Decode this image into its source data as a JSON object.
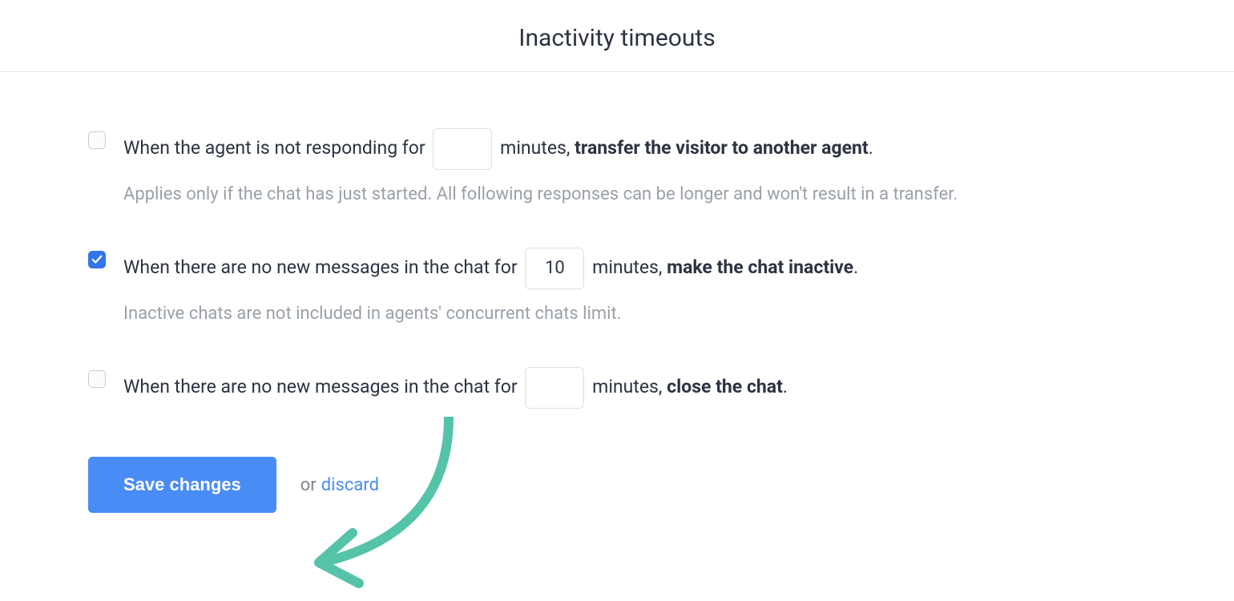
{
  "header": {
    "title": "Inactivity timeouts"
  },
  "options": {
    "transfer": {
      "checked": false,
      "pre": "When the agent is not responding for",
      "value": "",
      "mid": "minutes,",
      "bold": "transfer the visitor to another agent",
      "post": ".",
      "sub": "Applies only if the chat has just started. All following responses can be longer and won't result in a transfer."
    },
    "inactive": {
      "checked": true,
      "pre": "When there are no new messages in the chat for",
      "value": "10",
      "mid": "minutes,",
      "bold": "make the chat inactive",
      "post": ".",
      "sub": "Inactive chats are not included in agents' concurrent chats limit."
    },
    "close": {
      "checked": false,
      "pre": "When there are no new messages in the chat for",
      "value": "",
      "mid": "minutes,",
      "bold": "close the chat",
      "post": "."
    }
  },
  "actions": {
    "save": "Save changes",
    "or": "or",
    "discard": "discard"
  }
}
